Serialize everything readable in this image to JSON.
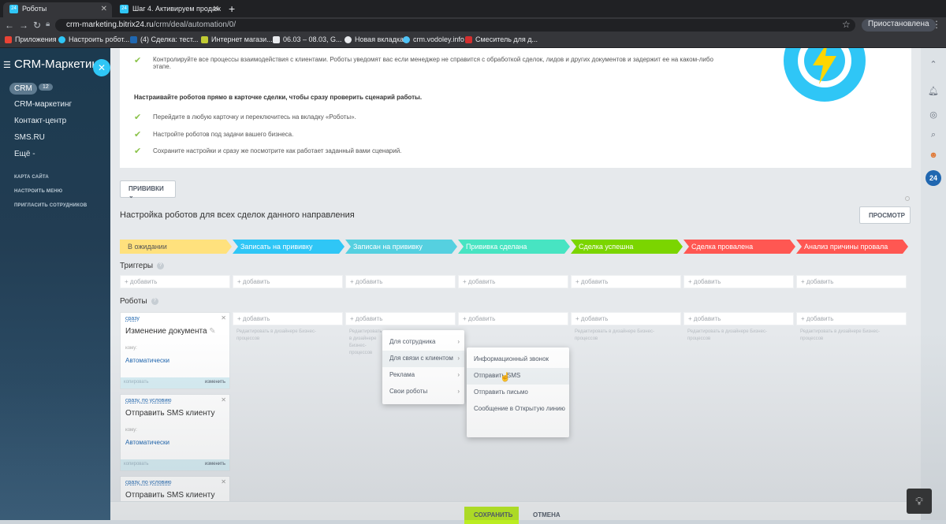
{
  "browser": {
    "tabs": [
      {
        "label": "Роботы",
        "favicon": "24"
      },
      {
        "label": "Шаг 4. Активируем продаж",
        "favicon": "24"
      }
    ],
    "url_host": "crm-marketing.bitrix24.ru",
    "url_path": "/crm/deal/automation/0/",
    "profile_label": "Приостановлена",
    "bookmarks": [
      "Приложения",
      "Настроить робот...",
      "(4) Сделка: тест...",
      "Интернет магази...",
      "06.03 – 08.03, G...",
      "Новая вкладка",
      "crm.vodoley.info",
      "Смеситель для д..."
    ]
  },
  "sidebar": {
    "title": "CRM-Маркетинг",
    "crm_label": "CRM",
    "crm_badge": "12",
    "items": [
      "CRM-маркетинг",
      "Контакт-центр",
      "SMS.RU",
      "Ещё -"
    ],
    "small_items": [
      "КАРТА САЙТА",
      "НАСТРОИТЬ МЕНЮ",
      "ПРИГЛАСИТЬ СОТРУДНИКОВ"
    ]
  },
  "info": {
    "line1": "Контролируйте все процессы взаимодействия с клиентами. Роботы уведомят вас если менеджер не справится с обработкой сделок, лидов и других документов и задержит ее на каком-либо",
    "line1b": "этапе.",
    "bold": "Настраивайте роботов прямо в карточке сделки, чтобы сразу проверить сценарий работы.",
    "steps": [
      "Перейдите в любую карточку и переключитесь на вкладку «Роботы».",
      "Настройте роботов под задачи вашего бизнеса.",
      "Сохраните настройки и сразу же посмотрите как работает заданный вами сценарий."
    ]
  },
  "toolbar": {
    "pipeline_label": "ПРИВИВКИ",
    "setup_title": "Настройка роботов для всех сделок данного направления",
    "preview_label": "ПРОСМОТР"
  },
  "stages": [
    {
      "label": "В ожидании",
      "color": "#ffe17d"
    },
    {
      "label": "Записать на прививку",
      "color": "#2fc6f6"
    },
    {
      "label": "Записан на прививку",
      "color": "#55d0e0"
    },
    {
      "label": "Прививка сделана",
      "color": "#47e4c2"
    },
    {
      "label": "Сделка успешна",
      "color": "#7bd500"
    },
    {
      "label": "Сделка провалена",
      "color": "#ff5752"
    },
    {
      "label": "Анализ причины провала",
      "color": "#ff5752"
    }
  ],
  "triggers": {
    "title": "Триггеры",
    "add_label": "+ добавить"
  },
  "robots": {
    "title": "Роботы",
    "add_label": "+ добавить",
    "hint": "Редактировать в дизайнере Бизнес-процессов",
    "cards": [
      {
        "when": "сразу",
        "name": "Изменение документа",
        "to": "кому:",
        "recipient": "Автоматически",
        "copy": "копировать",
        "edit": "изменить"
      },
      {
        "when": "сразу, по условию",
        "name": "Отправить SMS клиенту",
        "to": "кому:",
        "recipient": "Автоматически",
        "copy": "копировать",
        "edit": "изменить"
      },
      {
        "when": "сразу, по условию",
        "name": "Отправить SMS клиенту"
      }
    ]
  },
  "menu_main": [
    "Для сотрудника",
    "Для связи с клиентом",
    "Реклама",
    "Свои роботы"
  ],
  "menu_sub": [
    "Информационный звонок",
    "Отправить SMS",
    "Отправить письмо",
    "Сообщение в Открытую линию"
  ],
  "footer": {
    "save_label": "СОХРАНИТЬ",
    "cancel_label": "ОТМЕНА"
  },
  "rightbar": {
    "logo_label": "24"
  }
}
